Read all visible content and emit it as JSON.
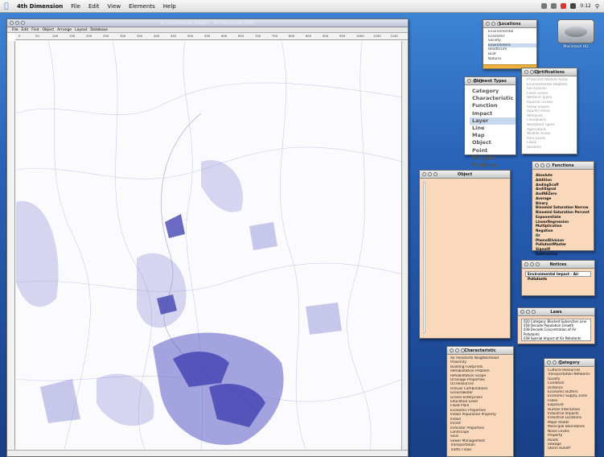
{
  "menubar": {
    "app": "4th Dimension",
    "items": [
      "File",
      "Edit",
      "View",
      "Elements",
      "Help"
    ],
    "clock": "0:12"
  },
  "main_window": {
    "title": "Environmental Impact - Air Pollutants (SM)",
    "submenu": [
      "File",
      "Edit",
      "Find",
      "Object",
      "Arrange",
      "Layout",
      "Database"
    ],
    "ruler_ticks": [
      "0",
      "50",
      "100",
      "150",
      "200",
      "250",
      "300",
      "350",
      "400",
      "450",
      "500",
      "550",
      "600",
      "650",
      "700",
      "750",
      "800",
      "850",
      "900",
      "950",
      "1000",
      "1050",
      "1100"
    ]
  },
  "disk": {
    "label": "Macintosh HD"
  },
  "locations": {
    "title": "Locations",
    "items": [
      "Environmental",
      "Economic",
      "Society",
      "Environment",
      "Health/Life",
      "Built",
      "Natural"
    ],
    "selected": 3
  },
  "element_types": {
    "title": "Element Types",
    "items": [
      "Category",
      "Characteristic",
      "Function",
      "Impact",
      "Layer",
      "Line",
      "Map",
      "Object",
      "Point",
      "Polygon",
      "Problem"
    ],
    "selected": 4
  },
  "certifications": {
    "title": "Certifications",
    "items": [
      "Protected Wildlife Areas",
      "Environmental Habitats",
      "Soil Erosion",
      "Flood Zones",
      "Wetland Types",
      "Riparian Zones",
      "Steep Slopes",
      "Aquifer Areas",
      "Wetlands",
      "Floodplains",
      "Woodland Types",
      "Agriculture",
      "Wildlife Areas",
      "Park Lands",
      "Lakes",
      "Streams"
    ]
  },
  "object": {
    "title": "Object"
  },
  "formulas": {
    "title": "Functions",
    "items": [
      "Absolute",
      "Addition",
      "AndingScaff",
      "AndiSignal",
      "AndNEZero",
      "Average",
      "Binary",
      "Binomial Saturation Narrow",
      "Binomial Saturation Percent",
      "Exponentiate",
      "LinearRegression",
      "Multiplication",
      "Negation",
      "Or",
      "PhenolDivision",
      "PollutantMaster",
      "SignalIf",
      "Subtraction"
    ]
  },
  "notices": {
    "title": "Notices",
    "value": "Environmental Impact - Air Pollutants"
  },
  "laws": {
    "title": "Laws",
    "items": [
      "020 Category: Blocked Subsection Line",
      "058 Decade Population Growth",
      "038 Decade Concentration of Air Pollutants",
      "038 Special Impact of Air Pollutants"
    ]
  },
  "characteristics": {
    "title": "Characteristic",
    "items": [
      "Air Pollutants Neighborhood",
      "Proximity",
      "Building Footprints",
      "Rehabilitation Problem",
      "Rehabilitation Scope",
      "Drainage Properties",
      "Oil Resources",
      "Oil/Gas Combinations",
      "Groundwater",
      "Gravel Enterprises",
      "Education Level",
      "Flood Plain",
      "Economic Properties",
      "Indian Population Property",
      "Indian",
      "Incest",
      "Indicator Properties",
      "Landscape",
      "Soils",
      "Sewer Management",
      "Transportation",
      "Traffic Flows"
    ]
  },
  "categories": {
    "title": "Category",
    "items": [
      "Cultural Resources",
      "Transportation Networks",
      "Quality",
      "Condition",
      "Distance",
      "Economic Buffers",
      "Economic Supply Zone",
      "Fallen",
      "Exposure",
      "Human Interaction",
      "Industrial Impacts",
      "Industrial Locations",
      "Major Roads",
      "Municipal Boundaries",
      "Noise Levels",
      "Property",
      "Roads",
      "Sewage",
      "Storm Runoff"
    ]
  }
}
